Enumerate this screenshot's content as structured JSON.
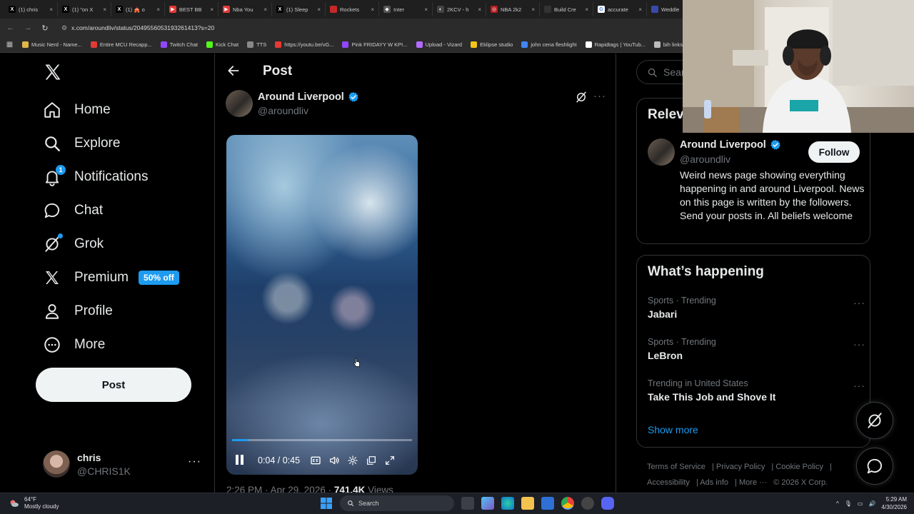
{
  "browser": {
    "tabs": [
      {
        "label": "(1) chris",
        "fav": "#000",
        "glyph": "X"
      },
      {
        "label": "(1) \"on X",
        "fav": "#000",
        "glyph": "X"
      },
      {
        "label": "(1) 🎪 o",
        "fav": "#000",
        "glyph": "X"
      },
      {
        "label": "BEST BB",
        "fav": "#e53935",
        "glyph": "▶"
      },
      {
        "label": "Nba You",
        "fav": "#e53935",
        "glyph": "▶"
      },
      {
        "label": "(1) Sleep",
        "fav": "#000",
        "glyph": "X"
      },
      {
        "label": "Rockets",
        "fav": "#c62828",
        "glyph": ""
      },
      {
        "label": "Inter",
        "fav": "#555",
        "glyph": "◆"
      },
      {
        "label": "2KCV - h",
        "fav": "#444",
        "glyph": "◐"
      },
      {
        "label": "NBA 2k2",
        "fav": "#b71c1c",
        "glyph": "◎"
      },
      {
        "label": "Build Cre",
        "fav": "#333",
        "glyph": ""
      },
      {
        "label": "accurate",
        "fav": "#fff",
        "glyph": "G"
      },
      {
        "label": "Weddle",
        "fav": "#3949ab",
        "glyph": ""
      }
    ],
    "url": "x.com/aroundliv/status/2049556053193261413?s=20",
    "bookmarks": [
      {
        "label": "Music Nerd - Name...",
        "color": "#e0b64a"
      },
      {
        "label": "Entire MCU Recapp...",
        "color": "#e53935"
      },
      {
        "label": "Twitch Chat",
        "color": "#9146ff"
      },
      {
        "label": "Kick Chat",
        "color": "#53fc18"
      },
      {
        "label": "TTS",
        "color": "#888"
      },
      {
        "label": "https://youtu.be/vG...",
        "color": "#e53935"
      },
      {
        "label": "Pink FRIDAYY W KPI...",
        "color": "#9146ff"
      },
      {
        "label": "Upload - Vizard",
        "color": "#b36bff"
      },
      {
        "label": "Eklipse studio",
        "color": "#f5c518"
      },
      {
        "label": "john cena fleshlight",
        "color": "#4285f4"
      },
      {
        "label": "Rapidtags | YouTub...",
        "color": "#fff"
      },
      {
        "label": "bih links",
        "color": "#bbb"
      }
    ]
  },
  "nav": {
    "items": [
      {
        "label": "Home",
        "icon": "home-icon"
      },
      {
        "label": "Explore",
        "icon": "search-icon"
      },
      {
        "label": "Notifications",
        "icon": "bell-icon",
        "badge": "1"
      },
      {
        "label": "Chat",
        "icon": "chat-icon"
      },
      {
        "label": "Grok",
        "icon": "grok-icon"
      },
      {
        "label": "Premium",
        "icon": "x-icon",
        "badge": "50% off"
      },
      {
        "label": "Profile",
        "icon": "profile-icon"
      },
      {
        "label": "More",
        "icon": "more-circle-icon"
      }
    ],
    "post_button": "Post",
    "account": {
      "display_name": "chris",
      "handle": "@CHRIS1K",
      "more": "···"
    }
  },
  "post": {
    "header_title": "Post",
    "author_name": "Around Liverpool",
    "author_handle": "@aroundliv",
    "more": "···",
    "video": {
      "time": "0:04 / 0:45",
      "progress": 0.09
    },
    "meta_time": "2:26 PM · Apr 29, 2026 · ",
    "meta_views_count": "741.4K",
    "meta_views_label": " Views"
  },
  "sidebar": {
    "search_placeholder": "Search",
    "relevant": {
      "title": "Relevant people",
      "name": "Around Liverpool",
      "handle": "@aroundliv",
      "follow": "Follow",
      "bio": "Weird news page showing everything happening in and around Liverpool. News on this page is written by the followers. Send your posts in. All beliefs welcome"
    },
    "trending": {
      "title": "What’s happening",
      "items": [
        {
          "context": "Sports · Trending",
          "name": "Jabari"
        },
        {
          "context": "Sports · Trending",
          "name": "LeBron"
        },
        {
          "context": "Trending in United States",
          "name": "Take This Job and Shove It"
        }
      ],
      "show_more": "Show more"
    },
    "footer": {
      "terms": "Terms of Service",
      "privacy": "Privacy Policy",
      "cookie": "Cookie Policy",
      "accessibility": "Accessibility",
      "ads": "Ads info",
      "more": "More ···",
      "copyright": "© 2026 X Corp."
    }
  },
  "taskbar": {
    "temp": "64°F",
    "weather": "Mostly cloudy",
    "search": "Search",
    "time": "5:29 AM",
    "date": "4/30/2026"
  }
}
